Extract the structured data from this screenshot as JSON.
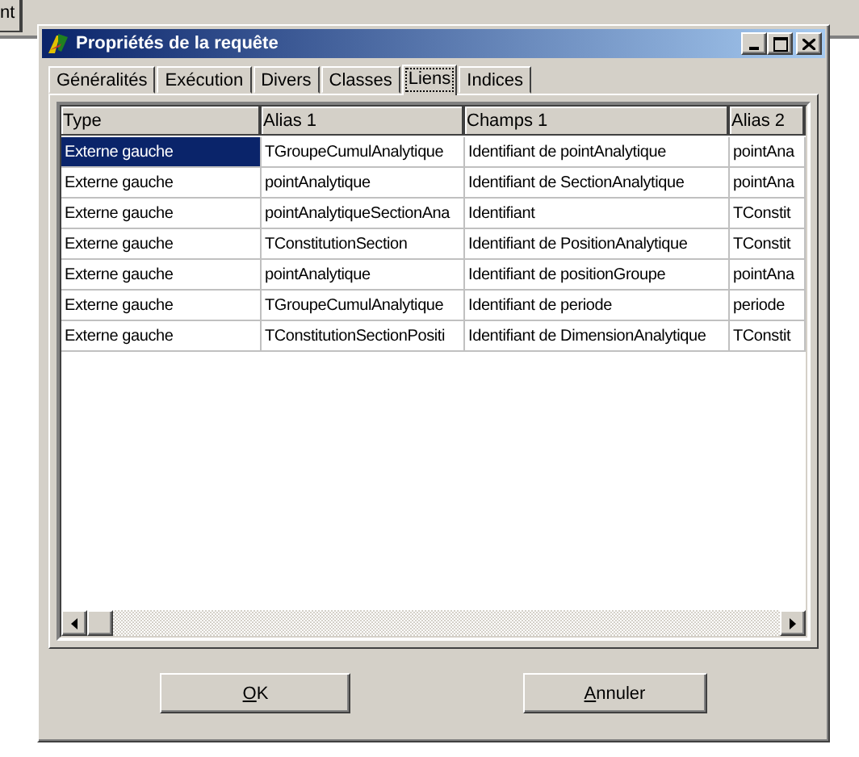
{
  "background_tab": {
    "label": "nt"
  },
  "window": {
    "title": "Propriétés de la requête"
  },
  "tabs": [
    {
      "label": "Généralités",
      "selected": false
    },
    {
      "label": "Exécution",
      "selected": false
    },
    {
      "label": "Divers",
      "selected": false
    },
    {
      "label": "Classes",
      "selected": false
    },
    {
      "label": "Liens",
      "selected": true
    },
    {
      "label": "Indices",
      "selected": false
    }
  ],
  "table": {
    "columns": [
      "Type",
      "Alias 1",
      "Champs 1",
      "Alias 2"
    ],
    "rows": [
      {
        "cells": [
          "Externe gauche",
          "TGroupeCumulAnalytique",
          "Identifiant de pointAnalytique",
          "pointAna"
        ],
        "selected": true
      },
      {
        "cells": [
          "Externe gauche",
          "pointAnalytique",
          "Identifiant de SectionAnalytique",
          "pointAna"
        ],
        "selected": false
      },
      {
        "cells": [
          "Externe gauche",
          "pointAnalytiqueSectionAna",
          "Identifiant",
          "TConstit"
        ],
        "selected": false
      },
      {
        "cells": [
          "Externe gauche",
          "TConstitutionSection",
          "Identifiant de PositionAnalytique",
          "TConstit"
        ],
        "selected": false
      },
      {
        "cells": [
          "Externe gauche",
          "pointAnalytique",
          "Identifiant de positionGroupe",
          "pointAna"
        ],
        "selected": false
      },
      {
        "cells": [
          "Externe gauche",
          "TGroupeCumulAnalytique",
          "Identifiant de periode",
          "periode"
        ],
        "selected": false
      },
      {
        "cells": [
          "Externe gauche",
          "TConstitutionSectionPositi",
          "Identifiant de DimensionAnalytique",
          "TConstit"
        ],
        "selected": false
      }
    ]
  },
  "buttons": [
    "OK",
    "Annuler"
  ]
}
